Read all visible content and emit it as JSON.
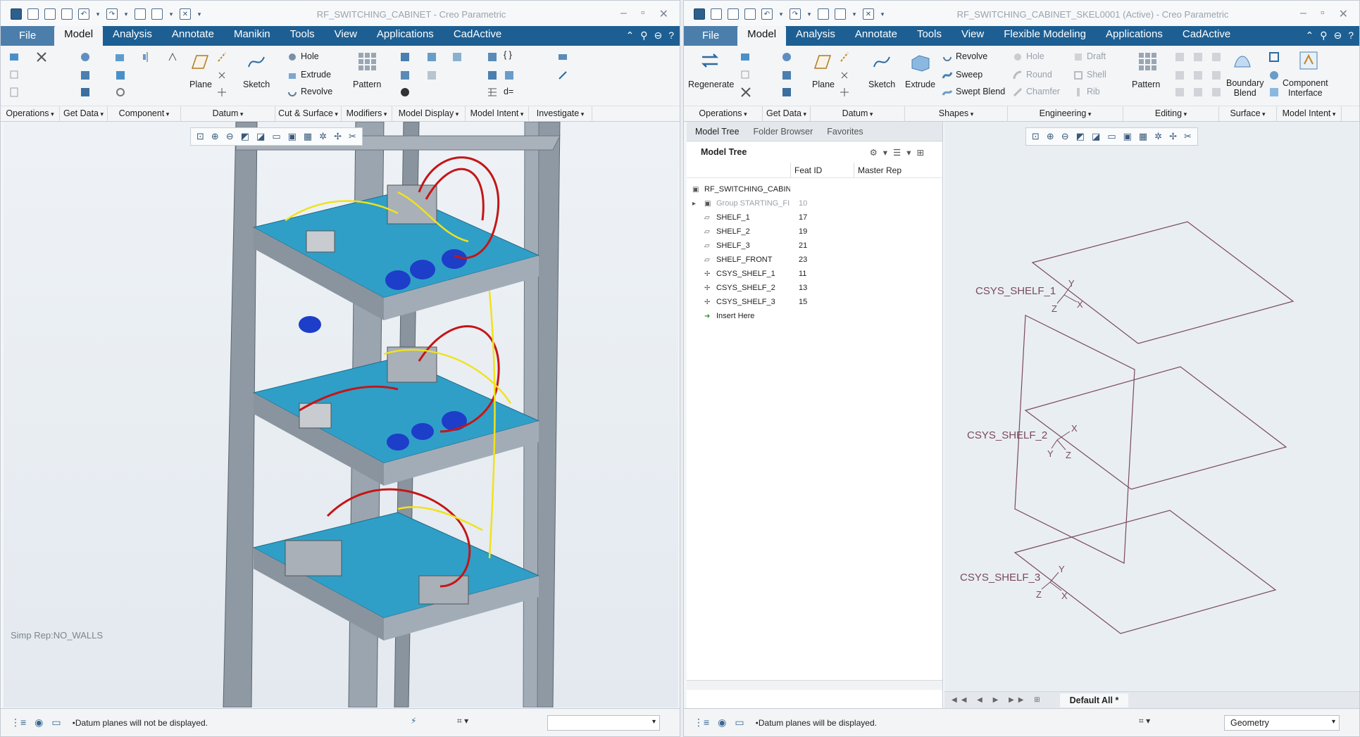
{
  "left_window": {
    "title": "RF_SWITCHING_CABINET - Creo Parametric",
    "menu": [
      "File",
      "Model",
      "Analysis",
      "Annotate",
      "Manikin",
      "Tools",
      "View",
      "Applications",
      "CadActive"
    ],
    "active_tab": "Model",
    "buttons": {
      "plane": "Plane",
      "sketch": "Sketch",
      "hole": "Hole",
      "extrude": "Extrude",
      "revolve": "Revolve",
      "pattern": "Pattern"
    },
    "groups": [
      "Operations",
      "Get Data",
      "Component",
      "Datum",
      "Cut & Surface",
      "Modifiers",
      "Model Display",
      "Model Intent",
      "Investigate"
    ],
    "simp_rep": "Simp Rep:NO_WALLS",
    "status_message": "Datum planes will not be displayed."
  },
  "right_window": {
    "title": "RF_SWITCHING_CABINET_SKEL0001 (Active) - Creo Parametric",
    "menu": [
      "File",
      "Model",
      "Analysis",
      "Annotate",
      "Tools",
      "View",
      "Flexible Modeling",
      "Applications",
      "CadActive"
    ],
    "active_tab": "Model",
    "buttons": {
      "regenerate": "Regenerate",
      "plane": "Plane",
      "sketch": "Sketch",
      "extrude": "Extrude",
      "revolve": "Revolve",
      "sweep": "Sweep",
      "swept_blend": "Swept Blend",
      "hole": "Hole",
      "round": "Round",
      "chamfer": "Chamfer",
      "draft": "Draft",
      "shell": "Shell",
      "rib": "Rib",
      "pattern": "Pattern",
      "boundary_blend_1": "Boundary",
      "boundary_blend_2": "Blend",
      "component_interface_1": "Component",
      "component_interface_2": "Interface"
    },
    "groups": [
      "Operations",
      "Get Data",
      "Datum",
      "Shapes",
      "Engineering",
      "Editing",
      "Surface",
      "Model Intent"
    ],
    "tree_tabs": [
      "Model Tree",
      "Folder Browser",
      "Favorites"
    ],
    "tree_header": "Model Tree",
    "tree_columns": [
      "Feat ID",
      "Master Rep"
    ],
    "tree_items": [
      {
        "name": "RF_SWITCHING_CABINE",
        "id": ""
      },
      {
        "name": "Group STARTING_FI",
        "id": "10"
      },
      {
        "name": "SHELF_1",
        "id": "17"
      },
      {
        "name": "SHELF_2",
        "id": "19"
      },
      {
        "name": "SHELF_3",
        "id": "21"
      },
      {
        "name": "SHELF_FRONT",
        "id": "23"
      },
      {
        "name": "CSYS_SHELF_1",
        "id": "11"
      },
      {
        "name": "CSYS_SHELF_2",
        "id": "13"
      },
      {
        "name": "CSYS_SHELF_3",
        "id": "15"
      },
      {
        "name": "Insert Here",
        "id": ""
      }
    ],
    "csys_labels": [
      "CSYS_SHELF_1",
      "CSYS_SHELF_2",
      "CSYS_SHELF_3"
    ],
    "axis_letters": {
      "x": "X",
      "y": "Y",
      "z": "Z"
    },
    "layer_state": "Default All *",
    "status_message": "Datum planes will be displayed.",
    "filter_value": "Geometry"
  },
  "colors": {
    "menubar": "#1d5f93",
    "file_tab": "#4c7eab",
    "rack": "#8f99a3",
    "shelf": "#2f9fc8",
    "wire_red": "#c41616",
    "wire_yellow": "#f0e21c",
    "motor": "#1d3ec8",
    "datum": "#7a4a5a"
  }
}
